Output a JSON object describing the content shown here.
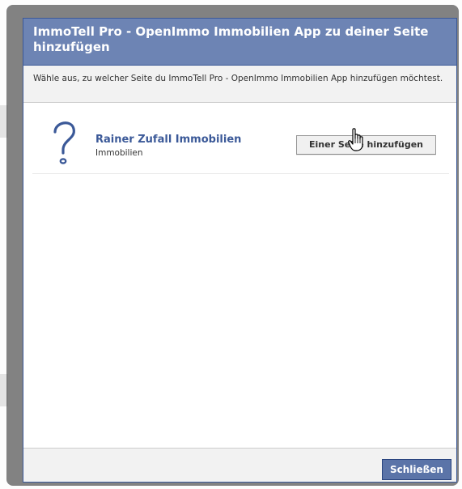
{
  "dialog": {
    "title": "ImmoTell Pro - OpenImmo Immobilien App zu deiner Seite hinzufügen",
    "instruction": "Wähle aus, zu welcher Seite du ImmoTell Pro - OpenImmo Immobilien App hinzufügen möchtest.",
    "close_label": "Schließen"
  },
  "pages": [
    {
      "name": "Rainer Zufall Immobilien",
      "category": "Immobilien",
      "icon": "question-mark-icon",
      "add_label": "Einer Seite hinzufügen"
    }
  ],
  "colors": {
    "header_bg": "#6d84b4",
    "link": "#3b5998",
    "close_button_bg": "#5b74a8"
  }
}
